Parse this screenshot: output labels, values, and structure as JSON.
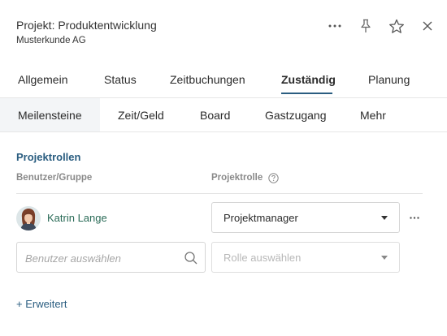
{
  "header": {
    "title": "Projekt: Produktentwicklung",
    "subtitle": "Musterkunde AG",
    "icons": [
      "more-horizontal-icon",
      "pin-icon",
      "star-icon",
      "close-icon"
    ]
  },
  "tabs_primary": [
    {
      "label": "Allgemein",
      "active": false
    },
    {
      "label": "Status",
      "active": false
    },
    {
      "label": "Zeitbuchungen",
      "active": false
    },
    {
      "label": "Zuständig",
      "active": true
    },
    {
      "label": "Planung",
      "active": false
    }
  ],
  "tabs_secondary": [
    {
      "label": "Meilensteine",
      "active": true
    },
    {
      "label": "Zeit/Geld",
      "active": false
    },
    {
      "label": "Board",
      "active": false
    },
    {
      "label": "Gastzugang",
      "active": false
    },
    {
      "label": "Mehr",
      "active": false
    }
  ],
  "roles": {
    "section_title": "Projektrollen",
    "col_user": "Benutzer/Gruppe",
    "col_role": "Projektrolle",
    "rows": [
      {
        "user": "Katrin Lange",
        "role": "Projektmanager"
      }
    ],
    "new_user_placeholder": "Benutzer auswählen",
    "new_role_placeholder": "Rolle auswählen"
  },
  "advanced_link": "+ Erweitert",
  "colors": {
    "accent": "#2a5d80",
    "user_link": "#2a6b57"
  }
}
